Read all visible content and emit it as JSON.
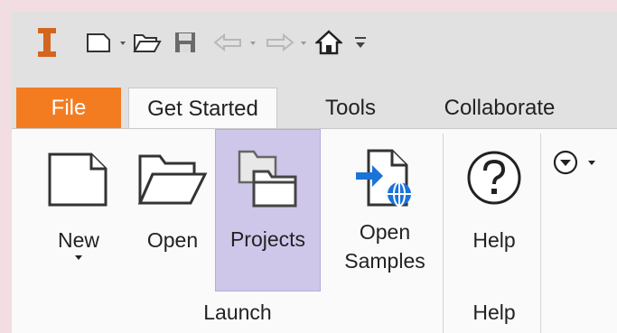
{
  "quick_access": {
    "icons": [
      "app-logo-icon",
      "new-file-icon",
      "open-folder-icon",
      "save-icon",
      "undo-icon",
      "redo-icon",
      "home-icon",
      "customize-icon"
    ]
  },
  "tabs": [
    {
      "label": "File",
      "active": false,
      "color": "#f47c20"
    },
    {
      "label": "Get Started",
      "active": true
    },
    {
      "label": "Tools",
      "active": false
    },
    {
      "label": "Collaborate",
      "active": false
    }
  ],
  "ribbon": {
    "groups": [
      {
        "label": "Launch",
        "buttons": [
          {
            "label": "New",
            "icon": "new-document-icon",
            "has_dropdown": true
          },
          {
            "label": "Open",
            "icon": "open-folder-icon"
          },
          {
            "label": "Projects",
            "icon": "projects-icon",
            "selected": true
          },
          {
            "label_line1": "Open",
            "label_line2": "Samples",
            "icon": "open-samples-icon"
          }
        ]
      },
      {
        "label": "Help",
        "buttons": [
          {
            "label": "Help",
            "icon": "help-icon"
          }
        ]
      }
    ]
  },
  "colors": {
    "accent_file_tab": "#f47c20",
    "selected_button": "#cfc7ea",
    "logo": "#d4651f",
    "sample_arrow": "#1a73d9"
  }
}
